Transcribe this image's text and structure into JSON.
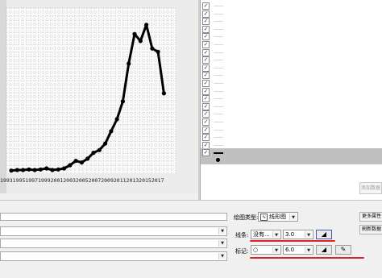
{
  "chart_data": {
    "type": "line",
    "x": [
      0,
      1,
      2,
      3,
      4,
      5,
      6,
      7,
      8,
      9,
      10,
      11,
      12,
      13,
      14,
      15,
      16,
      17,
      18,
      19,
      20,
      21,
      22,
      23,
      24,
      25,
      26
    ],
    "values": [
      2,
      3,
      3,
      4,
      3,
      4,
      6,
      3,
      4,
      6,
      12,
      20,
      17,
      24,
      35,
      40,
      52,
      75,
      97,
      130,
      200,
      255,
      242,
      272,
      228,
      222,
      145
    ],
    "ylim": [
      0,
      300
    ],
    "marker": "circle",
    "line_width": "3.0",
    "marker_size": "6.0",
    "grid": "dotted",
    "x_tick_text": "1993199519971999200120032005200720092011201320152017"
  },
  "series_list": {
    "row_count": 20,
    "selected_index": 19,
    "add_data_label": "添加数据"
  },
  "panel": {
    "plot_type_label": "绘图类型:",
    "plot_type_value": "线形图",
    "more_props_label": "更多属性",
    "refresh_label": "刷新数据",
    "line_label": "线条:",
    "line_style_value": "没有...",
    "line_width_value": "3.0",
    "marker_label": "标记:",
    "marker_shape_value": "○",
    "marker_size_value": "6.0"
  },
  "colors": {
    "highlight_underline": "#e0232a",
    "line_color": "#000000"
  }
}
